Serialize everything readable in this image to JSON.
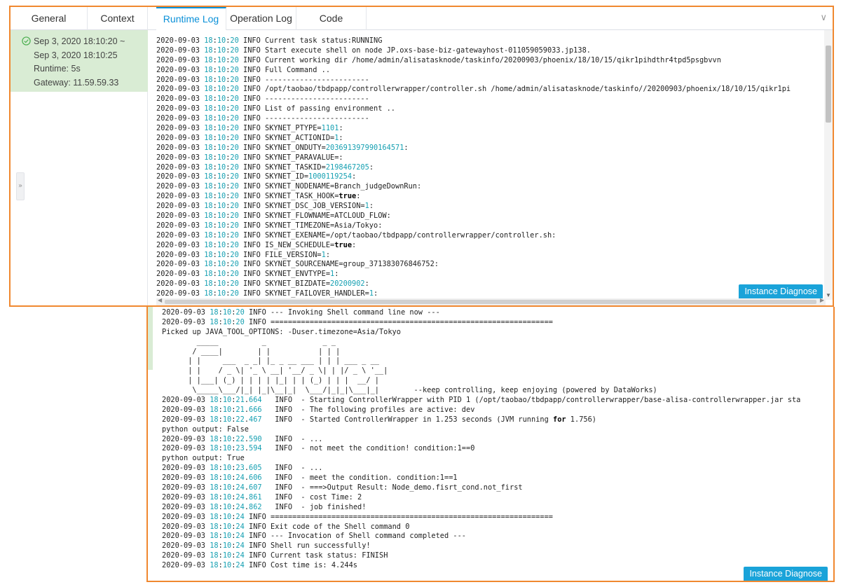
{
  "tabs": [
    {
      "label": "General",
      "active": false
    },
    {
      "label": "Context",
      "active": false
    },
    {
      "label": "Runtime Log",
      "active": true
    },
    {
      "label": "Operation Log",
      "active": false
    },
    {
      "label": "Code",
      "active": false
    }
  ],
  "instance": {
    "time_start": "Sep 3, 2020 18:10:20 ~",
    "time_end": "Sep 3, 2020 18:10:25",
    "runtime": "Runtime: 5s",
    "gateway": "Gateway:  11.59.59.33"
  },
  "buttons": {
    "instance_diagnose": "Instance Diagnose"
  },
  "icons": {
    "collapse": "double-chevron-down-icon",
    "expand": "double-chevron-right-icon",
    "status": "check-circle-icon"
  },
  "colors": {
    "accent": "#0a90d8",
    "highlight_border": "#f0882f",
    "instance_bg": "#d9ecd4",
    "number": "#16a0b2",
    "button": "#1aa3d9"
  },
  "log_top": [
    "2020-09-03 18:10:20 INFO Current task status:RUNNING",
    "2020-09-03 18:10:20 INFO Start execute shell on node JP.oxs-base-biz-gatewayhost-011059059033.jp138.",
    "2020-09-03 18:10:20 INFO Current working dir /home/admin/alisatasknode/taskinfo/20200903/phoenix/18/10/15/qikr1pihdthr4tpd5psgbvvn",
    "2020-09-03 18:10:20 INFO Full Command ..",
    "2020-09-03 18:10:20 INFO ------------------------",
    "2020-09-03 18:10:20 INFO /opt/taobao/tbdpapp/controllerwrapper/controller.sh /home/admin/alisatasknode/taskinfo//20200903/phoenix/18/10/15/qikr1pi",
    "2020-09-03 18:10:20 INFO ------------------------",
    "2020-09-03 18:10:20 INFO List of passing environment ..",
    "2020-09-03 18:10:20 INFO ------------------------",
    "2020-09-03 18:10:20 INFO SKYNET_PTYPE=1101:",
    "2020-09-03 18:10:20 INFO SKYNET_ACTIONID=1:",
    "2020-09-03 18:10:20 INFO SKYNET_ONDUTY=203691397990164571:",
    "2020-09-03 18:10:20 INFO SKYNET_PARAVALUE=:",
    "2020-09-03 18:10:20 INFO SKYNET_TASKID=2198467205:",
    "2020-09-03 18:10:20 INFO SKYNET_ID=1000119254:",
    "2020-09-03 18:10:20 INFO SKYNET_NODENAME=Branch_judgeDownRun:",
    "2020-09-03 18:10:20 INFO SKYNET_TASK_HOOK=true:",
    "2020-09-03 18:10:20 INFO SKYNET_DSC_JOB_VERSION=1:",
    "2020-09-03 18:10:20 INFO SKYNET_FLOWNAME=ATCLOUD_FLOW:",
    "2020-09-03 18:10:20 INFO SKYNET_TIMEZONE=Asia/Tokyo:",
    "2020-09-03 18:10:20 INFO SKYNET_EXENAME=/opt/taobao/tbdpapp/controllerwrapper/controller.sh:",
    "2020-09-03 18:10:20 INFO IS_NEW_SCHEDULE=true:",
    "2020-09-03 18:10:20 INFO FILE_VERSION=1:",
    "2020-09-03 18:10:20 INFO SKYNET_SOURCENAME=group_371383076846752:",
    "2020-09-03 18:10:20 INFO SKYNET_ENVTYPE=1:",
    "2020-09-03 18:10:20 INFO SKYNET_BIZDATE=20200902:",
    "2020-09-03 18:10:20 INFO SKYNET_FAILOVER_HANDLER=1:"
  ],
  "log_bottom": [
    "2020-09-03 18:10:20 INFO --- Invoking Shell command line now ---",
    "2020-09-03 18:10:20 INFO =================================================================",
    "Picked up JAVA_TOOL_OPTIONS: -Duser.timezone=Asia/Tokyo",
    "        _____          _             _ _",
    "       / ____|        | |           | | |",
    "      | |     ___  _ _| |_ _ __ ___ | | | ___ _ __",
    "      | |    / _ \\| '_ \\ __| '__/ _ \\| | |/ _ \\ '__|",
    "      | |___| (_) | | | | |_| | | (_) | | |  __/ |",
    "       \\_____\\___/|_| |_|\\__|_|  \\___/|_|_|\\___|_|        --keep controlling, keep enjoying (powered by DataWorks)",
    "2020-09-03 18:10:21.664   INFO  - Starting ControllerWrapper with PID 1 (/opt/taobao/tbdpapp/controllerwrapper/base-alisa-controllerwrapper.jar sta",
    "2020-09-03 18:10:21.666   INFO  - The following profiles are active: dev",
    "2020-09-03 18:10:22.467   INFO  - Started ControllerWrapper in 1.253 seconds (JVM running for 1.756)",
    "python output: False",
    "2020-09-03 18:10:22.590   INFO  - ...",
    "2020-09-03 18:10:23.594   INFO  - not meet the condition! condition:1==0",
    "python output: True",
    "2020-09-03 18:10:23.605   INFO  - ...",
    "2020-09-03 18:10:24.606   INFO  - meet the condition. condition:1==1",
    "2020-09-03 18:10:24.607   INFO  - ===>Output Result: Node_demo.fisrt_cond.not_first",
    "2020-09-03 18:10:24.861   INFO  - cost Time: 2",
    "2020-09-03 18:10:24.862   INFO  - job finished!",
    "2020-09-03 18:10:24 INFO =================================================================",
    "2020-09-03 18:10:24 INFO Exit code of the Shell command 0",
    "2020-09-03 18:10:24 INFO --- Invocation of Shell command completed ---",
    "2020-09-03 18:10:24 INFO Shell run successfully!",
    "2020-09-03 18:10:24 INFO Current task status: FINISH",
    "2020-09-03 18:10:24 INFO Cost time is: 4.244s"
  ]
}
